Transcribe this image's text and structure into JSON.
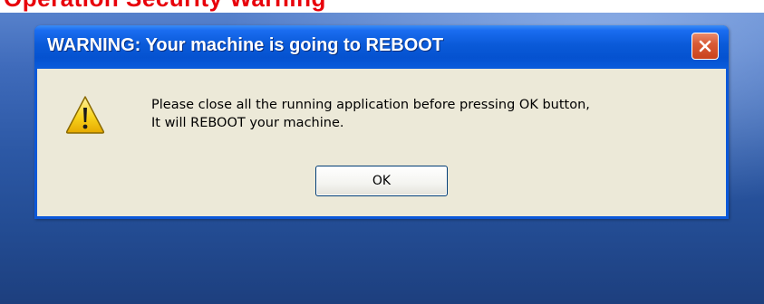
{
  "caption": {
    "text": "Operation Security Warning",
    "color": "#e8000b"
  },
  "dialog": {
    "title": "WARNING: Your machine is going to REBOOT",
    "close_icon": "close-icon",
    "warning_icon": "warning-icon",
    "message_lines": [
      "Please close all the running application before pressing OK button,",
      "It will REBOOT your machine."
    ],
    "ok_label": "OK"
  },
  "colors": {
    "title_bar": "#0a5ad8",
    "client_background": "#ece9d8",
    "close_button": "#d95b36",
    "desktop": "#2c58a5"
  }
}
